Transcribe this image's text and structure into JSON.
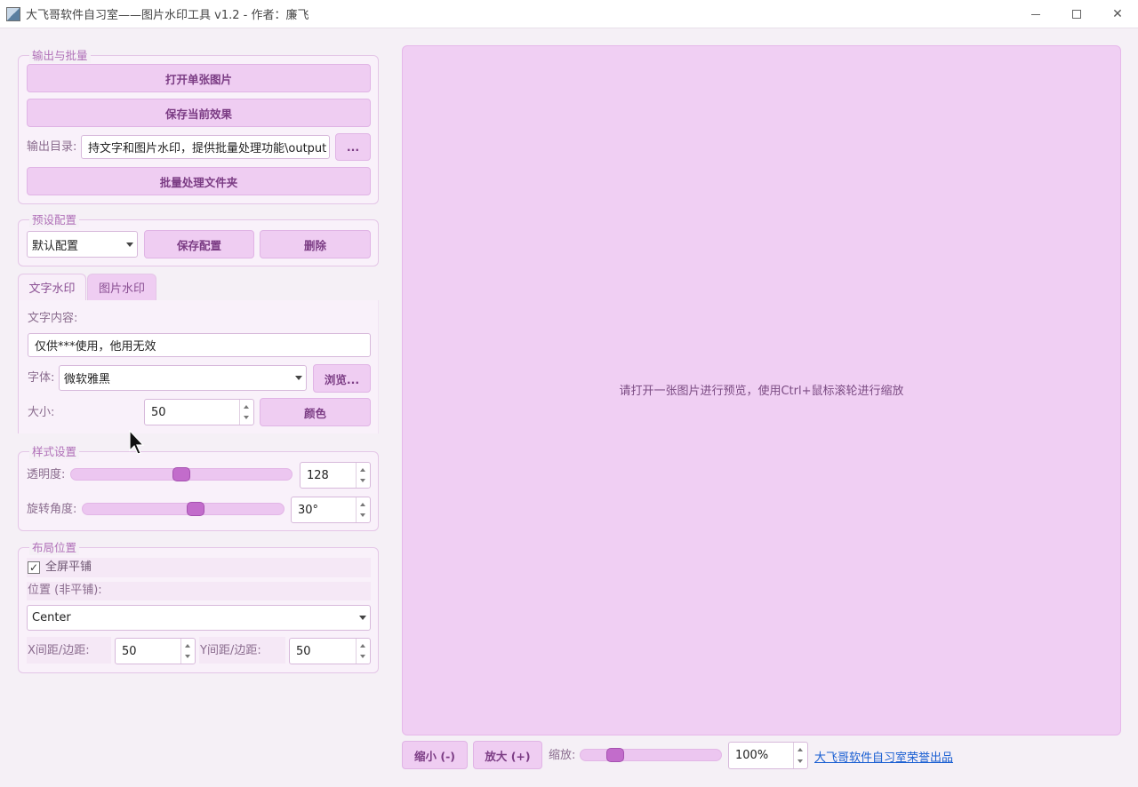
{
  "window": {
    "title": "大飞哥软件自习室——图片水印工具 v1.2 - 作者：廉飞",
    "minimize": "—",
    "close": "✕"
  },
  "output_group": {
    "title": "输出与批量",
    "open_single": "打开单张图片",
    "save_current": "保存当前效果",
    "output_dir_label": "输出目录:",
    "output_dir_value": "持文字和图片水印，提供批量处理功能\\output",
    "browse_dir": "...",
    "batch_folder": "批量处理文件夹"
  },
  "preset_group": {
    "title": "预设配置",
    "selected_preset": "默认配置",
    "save_preset": "保存配置",
    "delete_preset": "删除"
  },
  "tabs": [
    {
      "label": "文字水印"
    },
    {
      "label": "图片水印"
    }
  ],
  "text_tab": {
    "content_label": "文字内容:",
    "content_value": "仅供***使用，他用无效",
    "font_label": "字体:",
    "font_value": "微软雅黑",
    "font_browse": "浏览...",
    "size_label": "大小:",
    "size_value": "50",
    "color_button": "颜色"
  },
  "style_group": {
    "title": "样式设置",
    "opacity_label": "透明度:",
    "opacity_value": "128",
    "opacity_max": 255,
    "rotation_label": "旋转角度:",
    "rotation_value": "30°",
    "rotation_fraction": 0.57
  },
  "layout_group": {
    "title": "布局位置",
    "fullscreen_tile_label": "全屏平铺",
    "fullscreen_tile_checked": true,
    "check_glyph": "✓",
    "position_label": "位置 (非平铺):",
    "position_value": "Center",
    "x_spacing_label": "X间距/边距:",
    "x_spacing_value": "50",
    "y_spacing_label": "Y间距/边距:",
    "y_spacing_value": "50"
  },
  "preview": {
    "hint": "请打开一张图片进行预览，使用Ctrl+鼠标滚轮进行缩放"
  },
  "bottom_bar": {
    "zoom_out": "缩小 (-)",
    "zoom_in": "放大 (+)",
    "zoom_label": "缩放:",
    "zoom_value": "100%",
    "zoom_fraction": 0.21,
    "credit_link": "大飞哥软件自习室荣誉出品"
  },
  "colors": {
    "accent": "#c26ccb",
    "button_bg": "#efcdf2",
    "preview_bg": "#f0cff3",
    "link": "#1a5fd2"
  }
}
